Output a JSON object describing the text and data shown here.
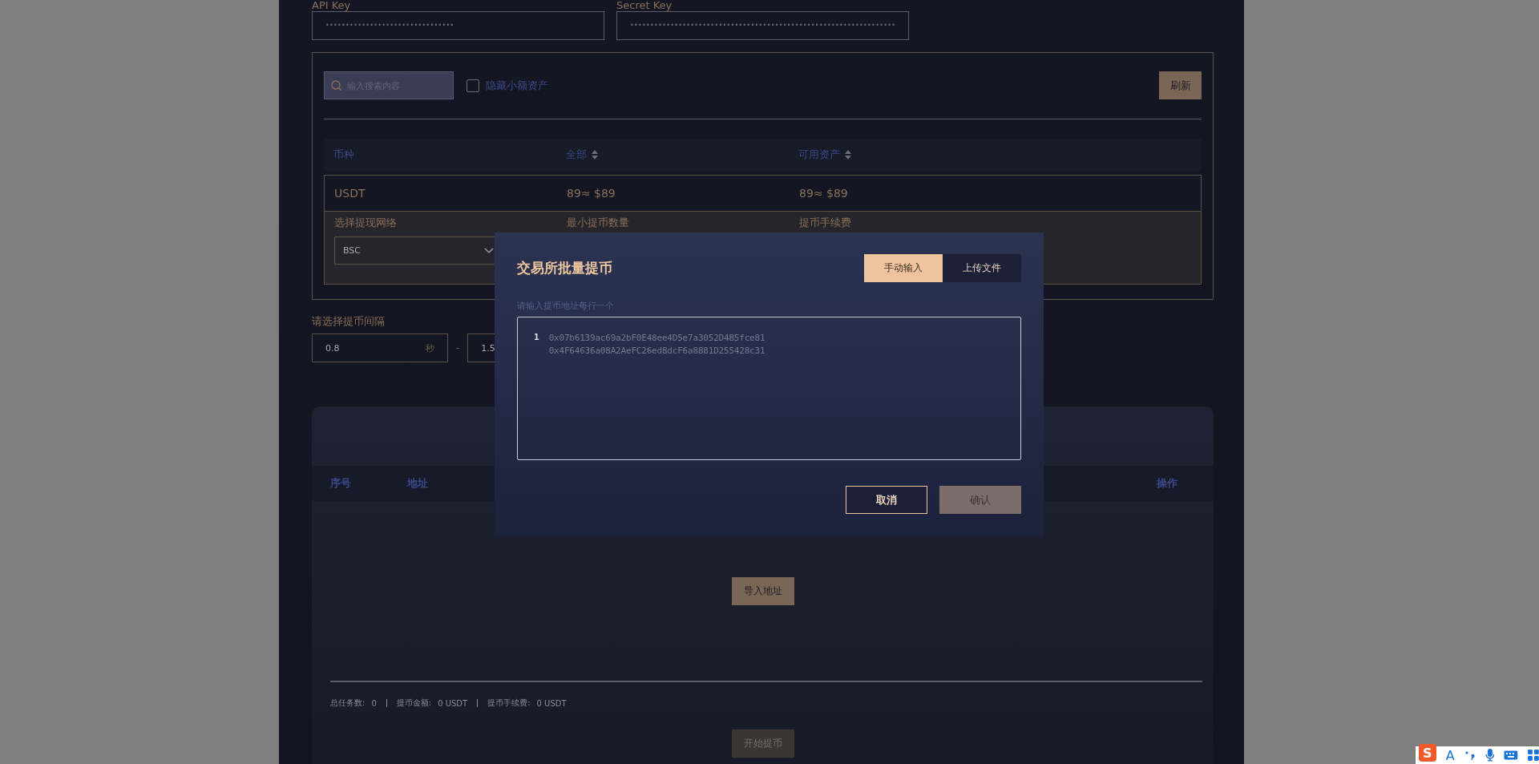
{
  "credentials": [
    {
      "label": "API Key",
      "value": "••••••••••••••••••••••••••••••••"
    },
    {
      "label": "Secret Key",
      "value": "••••••••••••••••••••••••••••••••••••••••••••••••••••••••••••••••••"
    }
  ],
  "assets": {
    "search": {
      "placeholder": "输入搜索内容"
    },
    "hide_small": {
      "label": "隐藏小额资产",
      "checked": false
    },
    "refresh_button": "刷新",
    "columns": [
      {
        "label": "币种",
        "sortable": false
      },
      {
        "label": "全部",
        "sortable": true
      },
      {
        "label": "可用资产",
        "sortable": true
      }
    ],
    "rows": [
      {
        "coin": "USDT",
        "total": "89≈ $89",
        "available": "89≈ $89",
        "expanded": true,
        "network_label": "选择提现网络",
        "network": "BSC",
        "min_label": "最小提币数量",
        "fee_label": "提币手续费"
      }
    ]
  },
  "interval": {
    "label": "请选择提币间隔",
    "from": "0.8",
    "unit": "秒",
    "separator": "-",
    "to": "1.5"
  },
  "tasks": {
    "columns": [
      {
        "label": "序号"
      },
      {
        "label": "地址"
      },
      {
        "label": "操作"
      }
    ],
    "import_button": "导入地址",
    "stats": [
      {
        "label": "总任务数:",
        "value": "0"
      },
      {
        "label": "提币金额:",
        "value": "0 USDT"
      },
      {
        "label": "提币手续费:",
        "value": "0 USDT"
      }
    ],
    "start_button": "开始提币"
  },
  "modal": {
    "title": "交易所批量提币",
    "tabs": [
      {
        "label": "手动输入",
        "selected": true
      },
      {
        "label": "上传文件",
        "selected": false
      }
    ],
    "hint": "请输入提币地址每行一个",
    "line_number": "1",
    "addresses": [
      "0x07b6139ac69a2bF0E48ee4D5e7a3052D4B5fce81",
      "0x4F64636a08A2AeFC26ed8dcF6a8881D255428c31"
    ],
    "buttons": [
      {
        "label": "取消",
        "kind": "secondary"
      },
      {
        "label": "确认",
        "kind": "primary"
      }
    ]
  },
  "ime_toolbar": {
    "logo": "S",
    "mode": "A"
  }
}
